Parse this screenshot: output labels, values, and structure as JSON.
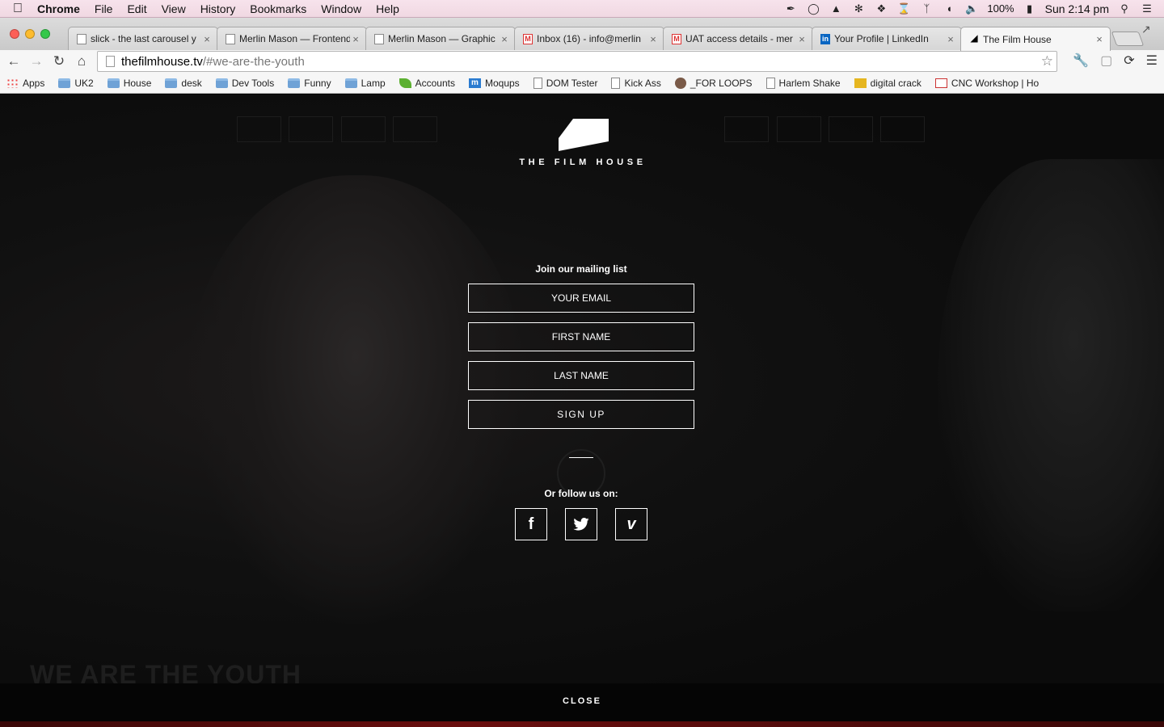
{
  "menubar": {
    "app_name": "Chrome",
    "items": [
      "File",
      "Edit",
      "View",
      "History",
      "Bookmarks",
      "Window",
      "Help"
    ],
    "battery": "100%",
    "clock": "Sun 2:14 pm"
  },
  "tabs": [
    {
      "title": "slick - the last carousel y",
      "icon": "page-icon"
    },
    {
      "title": "Merlin Mason — Frontend",
      "icon": "page-icon"
    },
    {
      "title": "Merlin Mason — Graphic",
      "icon": "page-icon"
    },
    {
      "title": "Inbox (16) - info@merlin",
      "icon": "gmail-icon",
      "badge": "16"
    },
    {
      "title": "UAT access details - mer",
      "icon": "gmail-icon"
    },
    {
      "title": "Your Profile | LinkedIn",
      "icon": "linkedin-icon"
    },
    {
      "title": "The Film House",
      "icon": "filmhouse-icon",
      "active": true
    }
  ],
  "toolbar": {
    "url_host": "thefilmhouse.tv",
    "url_path": "/#we-are-the-youth"
  },
  "bookmarks": [
    {
      "label": "Apps",
      "icon": "apps"
    },
    {
      "label": "UK2",
      "icon": "folder"
    },
    {
      "label": "House",
      "icon": "folder"
    },
    {
      "label": "desk",
      "icon": "folder"
    },
    {
      "label": "Dev Tools",
      "icon": "folder"
    },
    {
      "label": "Funny",
      "icon": "folder"
    },
    {
      "label": "Lamp",
      "icon": "folder"
    },
    {
      "label": "Accounts",
      "icon": "leaf"
    },
    {
      "label": "Moqups",
      "icon": "moqups"
    },
    {
      "label": "DOM Tester",
      "icon": "page"
    },
    {
      "label": "Kick Ass",
      "icon": "page"
    },
    {
      "label": "_FOR LOOPS",
      "icon": "avatar"
    },
    {
      "label": "Harlem Shake",
      "icon": "page"
    },
    {
      "label": "digital crack",
      "icon": "crack"
    },
    {
      "label": "CNC Workshop | Ho",
      "icon": "cnc"
    }
  ],
  "page": {
    "logo_text": "THE FILM HOUSE",
    "form_title": "Join our mailing list",
    "email_placeholder": "YOUR EMAIL",
    "first_name_placeholder": "FIRST NAME",
    "last_name_placeholder": "LAST NAME",
    "signup_label": "SIGN UP",
    "follow_label": "Or follow us on:",
    "social": [
      {
        "name": "facebook",
        "glyph": "f"
      },
      {
        "name": "twitter",
        "glyph": "t"
      },
      {
        "name": "vimeo",
        "glyph": "v"
      }
    ],
    "hero_title": "WE ARE THE YOUTH",
    "close_label": "CLOSE"
  },
  "colors": {
    "overlay_bg": "#0b0b0b",
    "text": "#ffffff",
    "menubar_tint": "#f3dde6"
  }
}
